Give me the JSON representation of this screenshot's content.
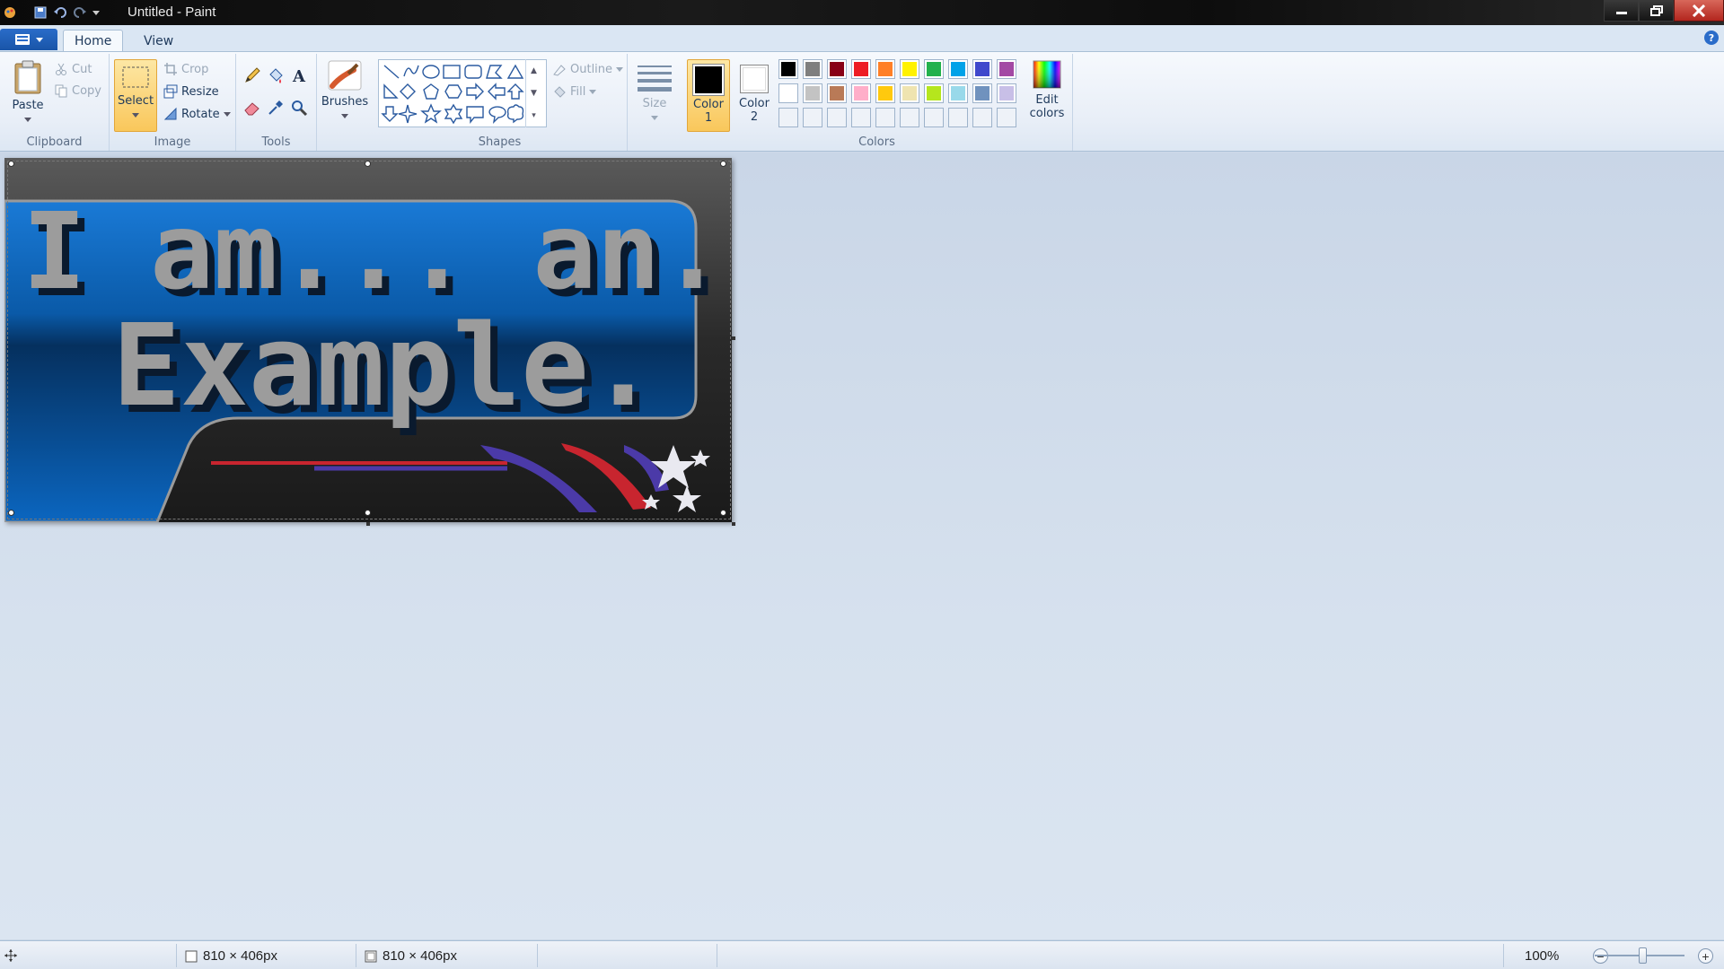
{
  "window": {
    "title": "Untitled - Paint",
    "qat": [
      "paint-icon",
      "save-icon",
      "undo-icon",
      "redo-icon",
      "customize-qat-icon"
    ],
    "controls": [
      "minimize",
      "restore",
      "close"
    ]
  },
  "tabs": [
    {
      "label": "Home",
      "active": true
    },
    {
      "label": "View",
      "active": false
    }
  ],
  "ribbon": {
    "clipboard": {
      "label": "Clipboard",
      "paste": "Paste",
      "cut": "Cut",
      "copy": "Copy"
    },
    "image": {
      "label": "Image",
      "select": "Select",
      "crop": "Crop",
      "resize": "Resize",
      "rotate": "Rotate"
    },
    "tools": {
      "label": "Tools",
      "items": [
        "pencil",
        "fill",
        "text",
        "eraser",
        "color-picker",
        "magnifier"
      ]
    },
    "brushes": {
      "label": "Brushes"
    },
    "shapes": {
      "label": "Shapes",
      "outline": "Outline",
      "fill": "Fill"
    },
    "size": {
      "label": "Size"
    },
    "colors": {
      "label": "Colors",
      "color1": "Color 1",
      "color1_line1": "Color",
      "color1_line2": "1",
      "color2_line1": "Color",
      "color2_line2": "2",
      "color1_value": "#000000",
      "color2_value": "#ffffff",
      "edit_line1": "Edit",
      "edit_line2": "colors",
      "palette_row1": [
        "#000000",
        "#7f7f7f",
        "#880015",
        "#ed1c24",
        "#ff7f27",
        "#fff200",
        "#22b14c",
        "#00a2e8",
        "#3f48cc",
        "#a349a4"
      ],
      "palette_row2": [
        "#ffffff",
        "#c3c3c3",
        "#b97a57",
        "#ffaec9",
        "#ffc90e",
        "#efe4b0",
        "#b5e61d",
        "#99d9ea",
        "#7092be",
        "#c8bfe7"
      ]
    }
  },
  "canvas": {
    "text_line1": "I am... an...",
    "text_line2": "Example."
  },
  "status": {
    "selection_size": "810 × 406px",
    "image_size": "810 × 406px",
    "zoom": "100%"
  }
}
